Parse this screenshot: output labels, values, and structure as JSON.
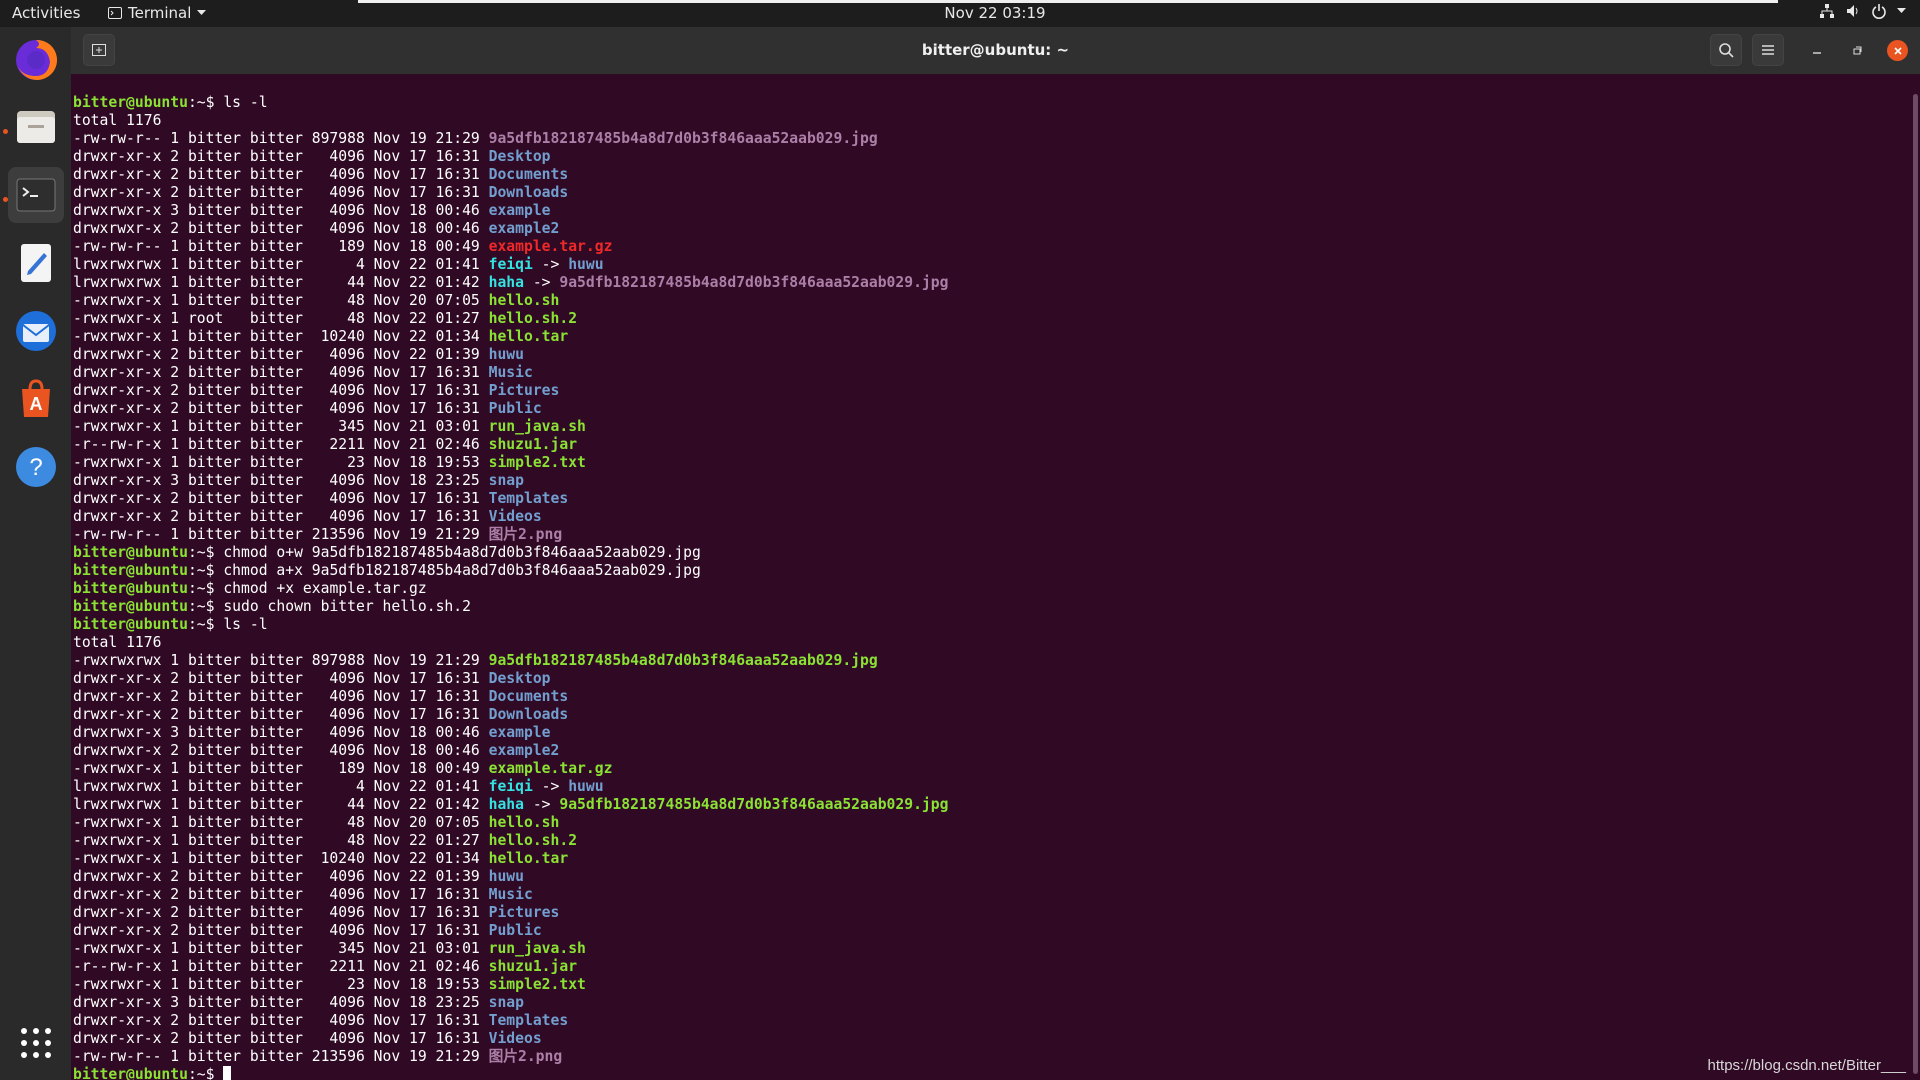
{
  "topbar": {
    "activities": "Activities",
    "app_name": "Terminal",
    "clock": "Nov 22  03:19"
  },
  "dock": {
    "items": [
      {
        "name": "firefox",
        "icon": "firefox-icon"
      },
      {
        "name": "files",
        "icon": "files-icon"
      },
      {
        "name": "terminal",
        "icon": "terminal-icon"
      },
      {
        "name": "text-editor",
        "icon": "text-editor-icon"
      },
      {
        "name": "thunderbird",
        "icon": "thunderbird-icon"
      },
      {
        "name": "software",
        "icon": "software-icon"
      },
      {
        "name": "help",
        "icon": "help-icon"
      },
      {
        "name": "show-apps",
        "icon": "grid-icon"
      }
    ]
  },
  "window": {
    "title": "bitter@ubuntu: ~"
  },
  "terminal": {
    "prompt": "bitter@ubuntu",
    "path": ":~$ ",
    "lines": [
      {
        "type": "cmd",
        "text": "ls -l"
      },
      {
        "type": "out",
        "text": "total 1176"
      },
      {
        "type": "entry",
        "meta": "-rw-rw-r-- 1 bitter bitter 897988 Nov 19 21:29 ",
        "name": "9a5dfb182187485b4a8d7d0b3f846aaa52aab029.jpg",
        "kind": "img"
      },
      {
        "type": "entry",
        "meta": "drwxr-xr-x 2 bitter bitter   4096 Nov 17 16:31 ",
        "name": "Desktop",
        "kind": "dir"
      },
      {
        "type": "entry",
        "meta": "drwxr-xr-x 2 bitter bitter   4096 Nov 17 16:31 ",
        "name": "Documents",
        "kind": "dir"
      },
      {
        "type": "entry",
        "meta": "drwxr-xr-x 2 bitter bitter   4096 Nov 17 16:31 ",
        "name": "Downloads",
        "kind": "dir"
      },
      {
        "type": "entry",
        "meta": "drwxrwxr-x 3 bitter bitter   4096 Nov 18 00:46 ",
        "name": "example",
        "kind": "dir"
      },
      {
        "type": "entry",
        "meta": "drwxrwxr-x 2 bitter bitter   4096 Nov 18 00:46 ",
        "name": "example2",
        "kind": "dir"
      },
      {
        "type": "entry",
        "meta": "-rw-rw-r-- 1 bitter bitter    189 Nov 18 00:49 ",
        "name": "example.tar.gz",
        "kind": "arc"
      },
      {
        "type": "entry",
        "meta": "lrwxrwxrwx 1 bitter bitter      4 Nov 22 01:41 ",
        "name": "feiqi",
        "kind": "sym",
        "arrow": " -> ",
        "target": "huwu",
        "target_kind": "dir"
      },
      {
        "type": "entry",
        "meta": "lrwxrwxrwx 1 bitter bitter     44 Nov 22 01:42 ",
        "name": "haha",
        "kind": "sym",
        "arrow": " -> ",
        "target": "9a5dfb182187485b4a8d7d0b3f846aaa52aab029.jpg",
        "target_kind": "img"
      },
      {
        "type": "entry",
        "meta": "-rwxrwxr-x 1 bitter bitter     48 Nov 20 07:05 ",
        "name": "hello.sh",
        "kind": "exe"
      },
      {
        "type": "entry",
        "meta": "-rwxrwxr-x 1 root   bitter     48 Nov 22 01:27 ",
        "name": "hello.sh.2",
        "kind": "exe"
      },
      {
        "type": "entry",
        "meta": "-rwxrwxr-x 1 bitter bitter  10240 Nov 22 01:34 ",
        "name": "hello.tar",
        "kind": "exe"
      },
      {
        "type": "entry",
        "meta": "drwxrwxr-x 2 bitter bitter   4096 Nov 22 01:39 ",
        "name": "huwu",
        "kind": "dir"
      },
      {
        "type": "entry",
        "meta": "drwxr-xr-x 2 bitter bitter   4096 Nov 17 16:31 ",
        "name": "Music",
        "kind": "dir"
      },
      {
        "type": "entry",
        "meta": "drwxr-xr-x 2 bitter bitter   4096 Nov 17 16:31 ",
        "name": "Pictures",
        "kind": "dir"
      },
      {
        "type": "entry",
        "meta": "drwxr-xr-x 2 bitter bitter   4096 Nov 17 16:31 ",
        "name": "Public",
        "kind": "dir"
      },
      {
        "type": "entry",
        "meta": "-rwxrwxr-x 1 bitter bitter    345 Nov 21 03:01 ",
        "name": "run_java.sh",
        "kind": "exe"
      },
      {
        "type": "entry",
        "meta": "-r--rw-r-x 1 bitter bitter   2211 Nov 21 02:46 ",
        "name": "shuzu1.jar",
        "kind": "exe"
      },
      {
        "type": "entry",
        "meta": "-rwxrwxr-x 1 bitter bitter     23 Nov 18 19:53 ",
        "name": "simple2.txt",
        "kind": "exe"
      },
      {
        "type": "entry",
        "meta": "drwxr-xr-x 3 bitter bitter   4096 Nov 18 23:25 ",
        "name": "snap",
        "kind": "dir"
      },
      {
        "type": "entry",
        "meta": "drwxr-xr-x 2 bitter bitter   4096 Nov 17 16:31 ",
        "name": "Templates",
        "kind": "dir"
      },
      {
        "type": "entry",
        "meta": "drwxr-xr-x 2 bitter bitter   4096 Nov 17 16:31 ",
        "name": "Videos",
        "kind": "dir"
      },
      {
        "type": "entry",
        "meta": "-rw-rw-r-- 1 bitter bitter 213596 Nov 19 21:29 ",
        "name": "图片2.png",
        "kind": "img"
      },
      {
        "type": "cmd",
        "text": "chmod o+w 9a5dfb182187485b4a8d7d0b3f846aaa52aab029.jpg"
      },
      {
        "type": "cmd",
        "text": "chmod a+x 9a5dfb182187485b4a8d7d0b3f846aaa52aab029.jpg"
      },
      {
        "type": "cmd",
        "text": "chmod +x example.tar.gz"
      },
      {
        "type": "cmd",
        "text": "sudo chown bitter hello.sh.2"
      },
      {
        "type": "cmd",
        "text": "ls -l"
      },
      {
        "type": "out",
        "text": "total 1176"
      },
      {
        "type": "entry",
        "meta": "-rwxrwxrwx 1 bitter bitter 897988 Nov 19 21:29 ",
        "name": "9a5dfb182187485b4a8d7d0b3f846aaa52aab029.jpg",
        "kind": "exe"
      },
      {
        "type": "entry",
        "meta": "drwxr-xr-x 2 bitter bitter   4096 Nov 17 16:31 ",
        "name": "Desktop",
        "kind": "dir"
      },
      {
        "type": "entry",
        "meta": "drwxr-xr-x 2 bitter bitter   4096 Nov 17 16:31 ",
        "name": "Documents",
        "kind": "dir"
      },
      {
        "type": "entry",
        "meta": "drwxr-xr-x 2 bitter bitter   4096 Nov 17 16:31 ",
        "name": "Downloads",
        "kind": "dir"
      },
      {
        "type": "entry",
        "meta": "drwxrwxr-x 3 bitter bitter   4096 Nov 18 00:46 ",
        "name": "example",
        "kind": "dir"
      },
      {
        "type": "entry",
        "meta": "drwxrwxr-x 2 bitter bitter   4096 Nov 18 00:46 ",
        "name": "example2",
        "kind": "dir"
      },
      {
        "type": "entry",
        "meta": "-rwxrwxr-x 1 bitter bitter    189 Nov 18 00:49 ",
        "name": "example.tar.gz",
        "kind": "exe"
      },
      {
        "type": "entry",
        "meta": "lrwxrwxrwx 1 bitter bitter      4 Nov 22 01:41 ",
        "name": "feiqi",
        "kind": "sym",
        "arrow": " -> ",
        "target": "huwu",
        "target_kind": "dir"
      },
      {
        "type": "entry",
        "meta": "lrwxrwxrwx 1 bitter bitter     44 Nov 22 01:42 ",
        "name": "haha",
        "kind": "sym",
        "arrow": " -> ",
        "target": "9a5dfb182187485b4a8d7d0b3f846aaa52aab029.jpg",
        "target_kind": "exe"
      },
      {
        "type": "entry",
        "meta": "-rwxrwxr-x 1 bitter bitter     48 Nov 20 07:05 ",
        "name": "hello.sh",
        "kind": "exe"
      },
      {
        "type": "entry",
        "meta": "-rwxrwxr-x 1 bitter bitter     48 Nov 22 01:27 ",
        "name": "hello.sh.2",
        "kind": "exe"
      },
      {
        "type": "entry",
        "meta": "-rwxrwxr-x 1 bitter bitter  10240 Nov 22 01:34 ",
        "name": "hello.tar",
        "kind": "exe"
      },
      {
        "type": "entry",
        "meta": "drwxrwxr-x 2 bitter bitter   4096 Nov 22 01:39 ",
        "name": "huwu",
        "kind": "dir"
      },
      {
        "type": "entry",
        "meta": "drwxr-xr-x 2 bitter bitter   4096 Nov 17 16:31 ",
        "name": "Music",
        "kind": "dir"
      },
      {
        "type": "entry",
        "meta": "drwxr-xr-x 2 bitter bitter   4096 Nov 17 16:31 ",
        "name": "Pictures",
        "kind": "dir"
      },
      {
        "type": "entry",
        "meta": "drwxr-xr-x 2 bitter bitter   4096 Nov 17 16:31 ",
        "name": "Public",
        "kind": "dir"
      },
      {
        "type": "entry",
        "meta": "-rwxrwxr-x 1 bitter bitter    345 Nov 21 03:01 ",
        "name": "run_java.sh",
        "kind": "exe"
      },
      {
        "type": "entry",
        "meta": "-r--rw-r-x 1 bitter bitter   2211 Nov 21 02:46 ",
        "name": "shuzu1.jar",
        "kind": "exe"
      },
      {
        "type": "entry",
        "meta": "-rwxrwxr-x 1 bitter bitter     23 Nov 18 19:53 ",
        "name": "simple2.txt",
        "kind": "exe"
      },
      {
        "type": "entry",
        "meta": "drwxr-xr-x 3 bitter bitter   4096 Nov 18 23:25 ",
        "name": "snap",
        "kind": "dir"
      },
      {
        "type": "entry",
        "meta": "drwxr-xr-x 2 bitter bitter   4096 Nov 17 16:31 ",
        "name": "Templates",
        "kind": "dir"
      },
      {
        "type": "entry",
        "meta": "drwxr-xr-x 2 bitter bitter   4096 Nov 17 16:31 ",
        "name": "Videos",
        "kind": "dir"
      },
      {
        "type": "entry",
        "meta": "-rw-rw-r-- 1 bitter bitter 213596 Nov 19 21:29 ",
        "name": "图片2.png",
        "kind": "img"
      },
      {
        "type": "prompt_only",
        "text": ""
      }
    ]
  },
  "watermark": "https://blog.csdn.net/Bitter___",
  "colors": {
    "terminal_bg": "#300a24",
    "prompt": "#8ae234",
    "dir": "#729fcf",
    "exe": "#8ae234",
    "symlink": "#34e2e2",
    "archive": "#ef2929",
    "image": "#ad7fa8",
    "accent": "#e95420"
  }
}
